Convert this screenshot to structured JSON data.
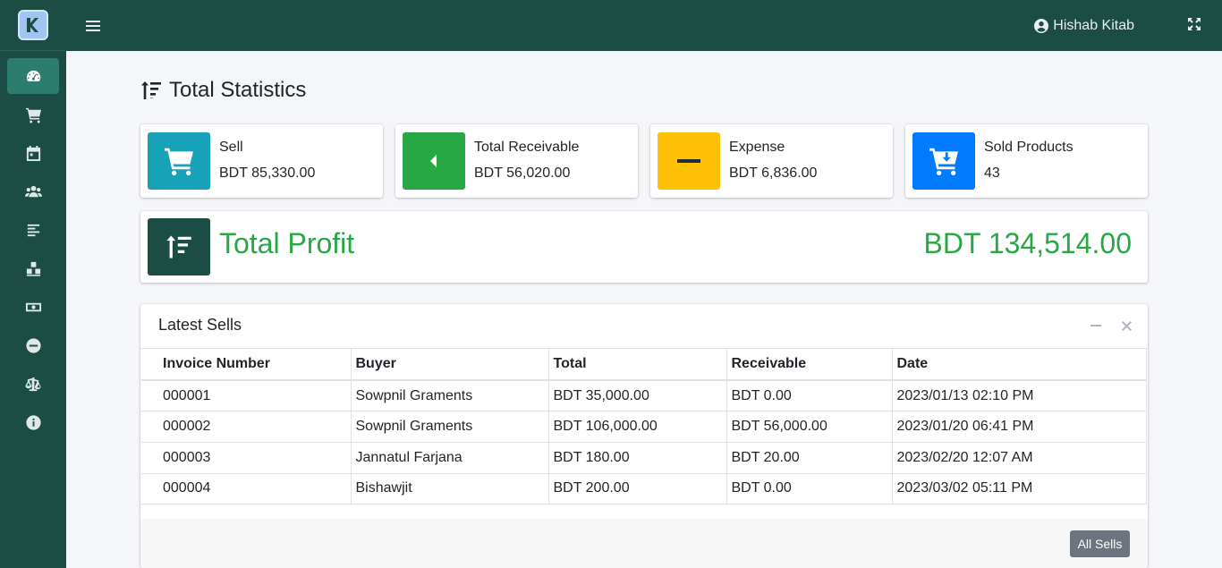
{
  "colors": {
    "sidebar_bg": "#1b4d45",
    "nav_active": "#2b7d6e",
    "sell": "#17a2b8",
    "receivable": "#28a745",
    "expense": "#ffc107",
    "sold_products": "#007bff",
    "profit_text": "#28a745"
  },
  "sidebar": {
    "items": [
      {
        "icon": "tachometer-icon",
        "active": true
      },
      {
        "icon": "cart-icon"
      },
      {
        "icon": "calendar-icon"
      },
      {
        "icon": "users-icon"
      },
      {
        "icon": "align-left-icon"
      },
      {
        "icon": "cubes-icon"
      },
      {
        "icon": "money-icon"
      },
      {
        "icon": "minus-circle-icon"
      },
      {
        "icon": "balance-scale-icon"
      },
      {
        "icon": "info-circle-icon"
      }
    ]
  },
  "topbar": {
    "user_name": "Hishab Kitab"
  },
  "page": {
    "title": "Total Statistics"
  },
  "stats": [
    {
      "label": "Sell",
      "value": "BDT 85,330.00",
      "icon": "cart-icon"
    },
    {
      "label": "Total Receivable",
      "value": "BDT 56,020.00",
      "icon": "caret-left-icon"
    },
    {
      "label": "Expense",
      "value": "BDT 6,836.00",
      "icon": "minus-icon"
    },
    {
      "label": "Sold Products",
      "value": "43",
      "icon": "cart-arrow-down-icon"
    }
  ],
  "profit": {
    "label": "Total Profit",
    "value": "BDT 134,514.00"
  },
  "latest_sells": {
    "title": "Latest Sells",
    "columns": [
      "Invoice Number",
      "Buyer",
      "Total",
      "Receivable",
      "Date"
    ],
    "rows": [
      [
        "000001",
        "Sowpnil Graments",
        "BDT 35,000.00",
        "BDT 0.00",
        "2023/01/13 02:10 PM"
      ],
      [
        "000002",
        "Sowpnil Graments",
        "BDT 106,000.00",
        "BDT 56,000.00",
        "2023/01/20 06:41 PM"
      ],
      [
        "000003",
        "Jannatul Farjana",
        "BDT 180.00",
        "BDT 20.00",
        "2023/02/20 12:07 AM"
      ],
      [
        "000004",
        "Bishawjit",
        "BDT 200.00",
        "BDT 0.00",
        "2023/03/02 05:11 PM"
      ]
    ],
    "footer_button": "All Sells"
  }
}
